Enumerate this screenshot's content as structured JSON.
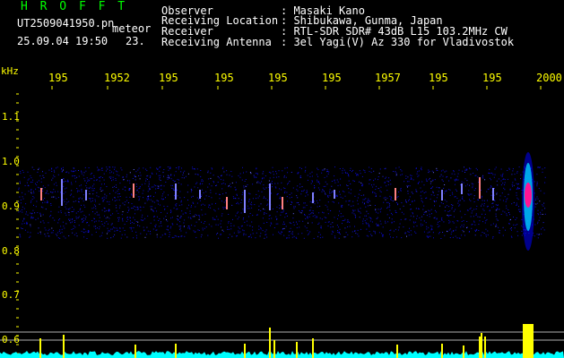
{
  "header": {
    "app_title": "H R O F F T",
    "filename": "UT2509041950.pn",
    "mode": "meteor",
    "date_time": "25.09.04 19:50",
    "frame_no": "23.",
    "fields": [
      {
        "label": "Observer",
        "value": ": Masaki Kano"
      },
      {
        "label": "Receiving Location",
        "value": ": Shibukawa, Gunma, Japan"
      },
      {
        "label": "Receiver",
        "value": ": RTL-SDR SDR# 43dB L15 103.2MHz CW"
      },
      {
        "label": "Receiving Antenna",
        "value": ": 3el Yagi(V) Az 330 for Vladivostok"
      }
    ]
  },
  "axes": {
    "y_unit": "kHz",
    "y_ticks": [
      "1.1",
      "1.0",
      "0.9",
      "0.8",
      "0.7",
      "0.6"
    ],
    "x_ticks": [
      "195",
      "1952",
      "195",
      "195",
      "195",
      "195",
      "1957",
      "195",
      "195",
      "2000"
    ]
  },
  "colors": {
    "background": "#000000",
    "header_text": "#ffffff",
    "title_green": "#00ff00",
    "axis_yellow": "#ffff00",
    "noise_blue": "#0a0ad0",
    "baseline_cyan": "#00ffff",
    "echo_magenta": "#ff1493"
  }
}
